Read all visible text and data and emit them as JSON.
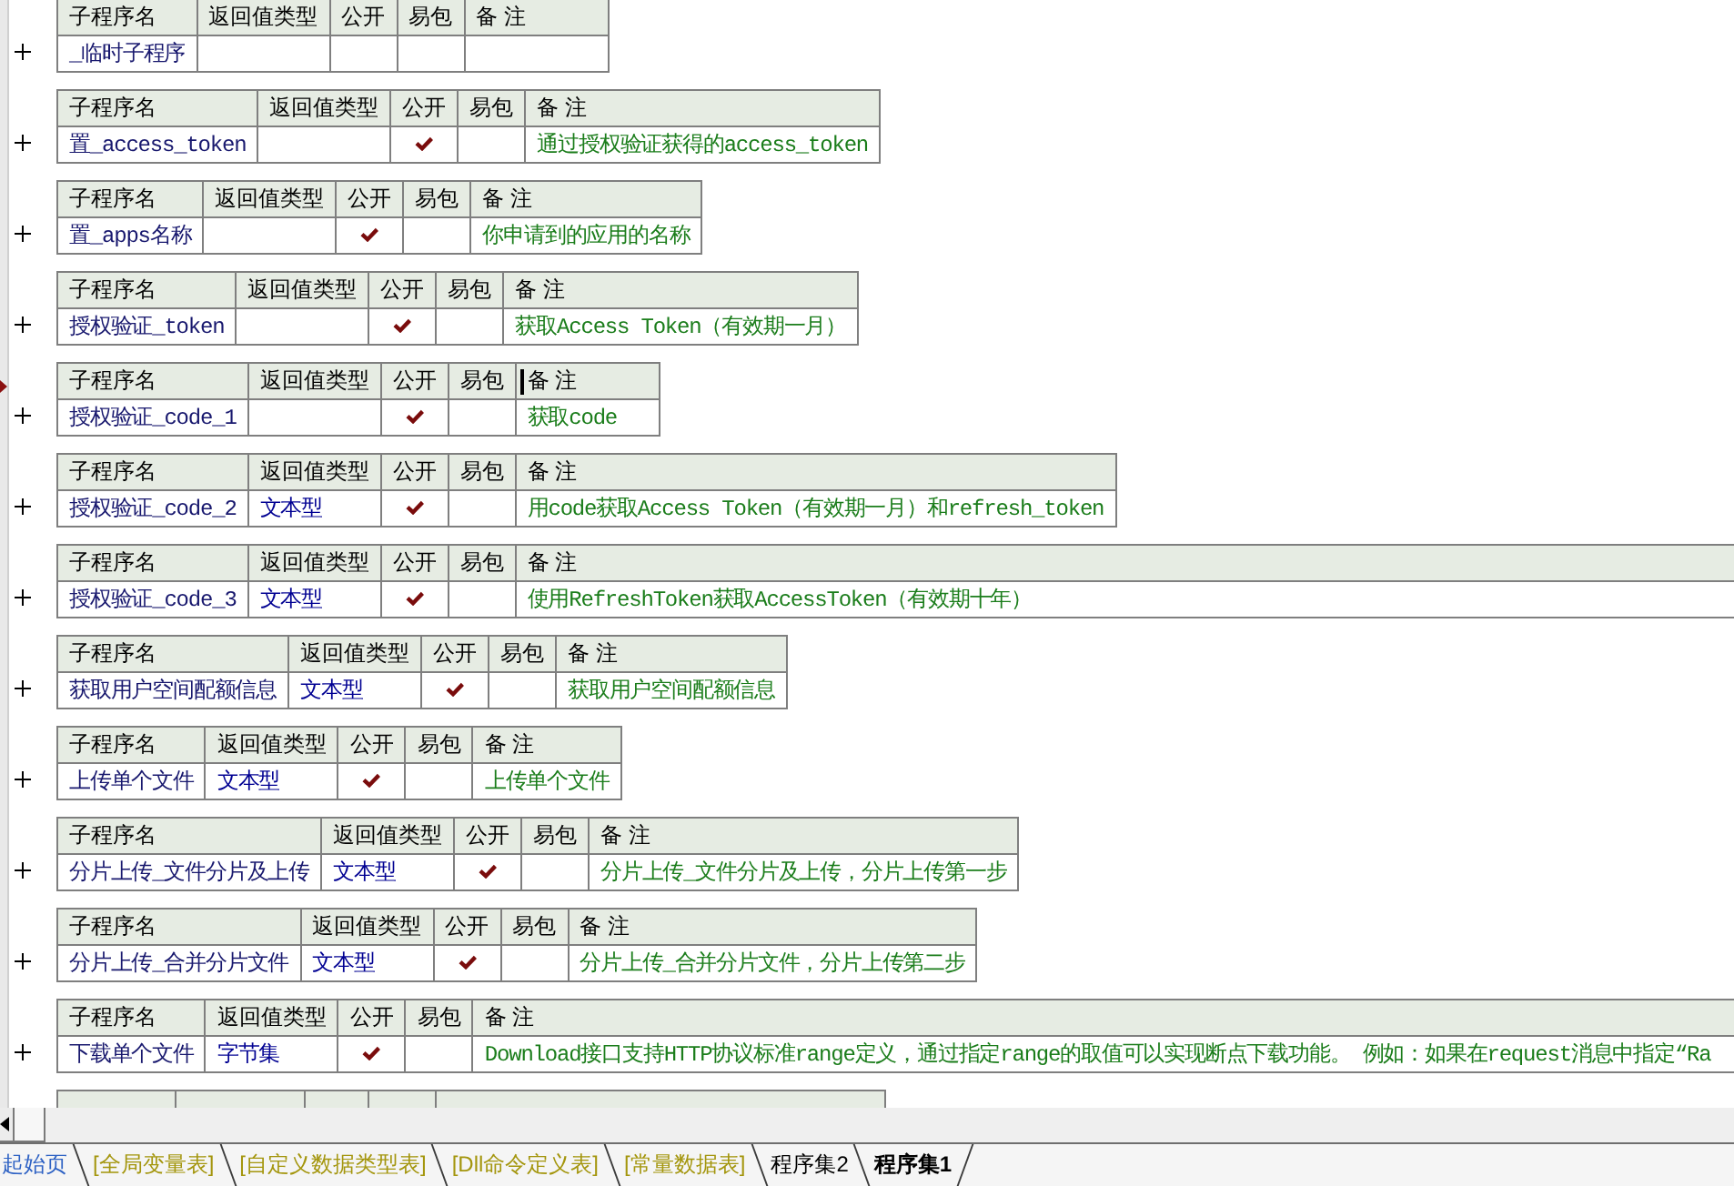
{
  "code_view": {
    "procedures": [
      {
        "columns": [
          "子程序名",
          "返回值类型",
          "公开",
          "易包",
          "备 注"
        ],
        "expanded": false,
        "name": "_临时子程序",
        "public": false,
        "easy_package": false,
        "current": false,
        "open_right": false
      },
      {
        "columns": [
          "子程序名",
          "返回值类型",
          "公开",
          "易包",
          "备 注"
        ],
        "expanded": false,
        "name": "置_access_token",
        "public": true,
        "easy_package": false,
        "remark": "通过授权验证获得的access_token",
        "current": false,
        "open_right": false
      },
      {
        "columns": [
          "子程序名",
          "返回值类型",
          "公开",
          "易包",
          "备 注"
        ],
        "expanded": false,
        "name": "置_apps名称",
        "public": true,
        "easy_package": false,
        "remark": "你申请到的应用的名称",
        "current": false,
        "open_right": false
      },
      {
        "columns": [
          "子程序名",
          "返回值类型",
          "公开",
          "易包",
          "备 注"
        ],
        "expanded": false,
        "name": "授权验证_token",
        "public": true,
        "easy_package": false,
        "remark": "获取Access Token（有效期一月）",
        "current": false,
        "open_right": false
      },
      {
        "columns": [
          "子程序名",
          "返回值类型",
          "公开",
          "易包",
          "备 注"
        ],
        "expanded": false,
        "name": "授权验证_code_1",
        "public": true,
        "easy_package": false,
        "remark": "获取code",
        "current": true,
        "open_right": false
      },
      {
        "columns": [
          "子程序名",
          "返回值类型",
          "公开",
          "易包",
          "备 注"
        ],
        "expanded": false,
        "name": "授权验证_code_2",
        "return_type": "文本型",
        "public": true,
        "easy_package": false,
        "remark": "用code获取Access Token（有效期一月）和refresh_token",
        "current": false,
        "open_right": false
      },
      {
        "columns": [
          "子程序名",
          "返回值类型",
          "公开",
          "易包",
          "备 注"
        ],
        "expanded": false,
        "name": "授权验证_code_3",
        "return_type": "文本型",
        "public": true,
        "easy_package": false,
        "remark": "使用RefreshToken获取AccessToken（有效期十年）",
        "current": false,
        "open_right": true
      },
      {
        "columns": [
          "子程序名",
          "返回值类型",
          "公开",
          "易包",
          "备 注"
        ],
        "expanded": false,
        "name": "获取用户空间配额信息",
        "return_type": "文本型",
        "public": true,
        "easy_package": false,
        "remark": "获取用户空间配额信息",
        "current": false,
        "open_right": false
      },
      {
        "columns": [
          "子程序名",
          "返回值类型",
          "公开",
          "易包",
          "备 注"
        ],
        "expanded": false,
        "name": "上传单个文件",
        "return_type": "文本型",
        "public": true,
        "easy_package": false,
        "remark": "上传单个文件",
        "current": false,
        "open_right": false
      },
      {
        "columns": [
          "子程序名",
          "返回值类型",
          "公开",
          "易包",
          "备 注"
        ],
        "expanded": false,
        "name": "分片上传_文件分片及上传",
        "return_type": "文本型",
        "public": true,
        "easy_package": false,
        "remark": "分片上传_文件分片及上传，分片上传第一步",
        "current": false,
        "open_right": false
      },
      {
        "columns": [
          "子程序名",
          "返回值类型",
          "公开",
          "易包",
          "备 注"
        ],
        "expanded": false,
        "name": "分片上传_合并分片文件",
        "return_type": "文本型",
        "public": true,
        "easy_package": false,
        "remark": "分片上传_合并分片文件，分片上传第二步",
        "current": false,
        "open_right": false
      },
      {
        "columns": [
          "子程序名",
          "返回值类型",
          "公开",
          "易包",
          "备 注"
        ],
        "expanded": false,
        "name": "下载单个文件",
        "return_type": "字节集",
        "public": true,
        "easy_package": false,
        "remark": "Download接口支持HTTP协议标准range定义，通过指定range的取值可以实现断点下载功能。 例如：如果在request消息中指定“Ra",
        "current": false,
        "open_right": true
      }
    ]
  },
  "tab_bar": {
    "tabs": [
      {
        "label": "起始页",
        "kind": "start",
        "selected": false
      },
      {
        "label": "[全局变量表]",
        "kind": "table",
        "selected": false
      },
      {
        "label": "[自定义数据类型表]",
        "kind": "table",
        "selected": false
      },
      {
        "label": "[Dll命令定义表]",
        "kind": "table",
        "selected": false
      },
      {
        "label": "[常量数据表]",
        "kind": "table",
        "selected": false
      },
      {
        "label": "程序集2",
        "kind": "module",
        "selected": false
      },
      {
        "label": "程序集1",
        "kind": "module",
        "selected": true
      }
    ]
  }
}
